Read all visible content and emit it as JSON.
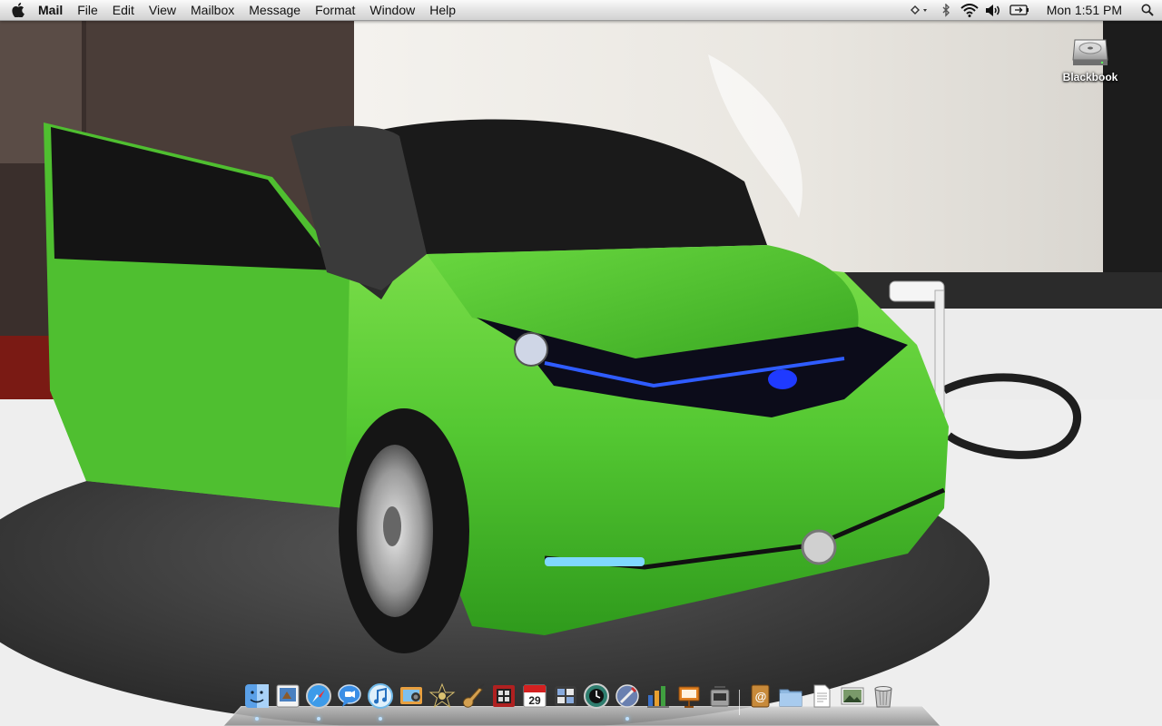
{
  "menubar": {
    "app_name": "Mail",
    "menus": [
      "File",
      "Edit",
      "View",
      "Mailbox",
      "Message",
      "Format",
      "Window",
      "Help"
    ],
    "clock": "Mon 1:51 PM",
    "status_icons": [
      "time-machine-icon",
      "bluetooth-icon",
      "wifi-icon",
      "volume-icon",
      "battery-icon"
    ]
  },
  "desktop": {
    "drive_label": "Blackbook",
    "drive_icon": "hard-drive-icon",
    "wallpaper": {
      "subject": "green-concept-car",
      "car_color": "#5ed03a",
      "floor_color": "#ededed",
      "turntable_color": "#3a3a3a"
    }
  },
  "dock": {
    "apps": [
      {
        "name": "finder",
        "icon": "finder-icon",
        "color": "#5aa0e8"
      },
      {
        "name": "preview",
        "icon": "preview-icon",
        "color": "#4a80c0"
      },
      {
        "name": "safari",
        "icon": "safari-icon",
        "color": "#3d9be9"
      },
      {
        "name": "ichat",
        "icon": "ichat-icon",
        "color": "#3a8ee6"
      },
      {
        "name": "itunes",
        "icon": "itunes-icon",
        "color": "#6fb8e8"
      },
      {
        "name": "iphoto",
        "icon": "iphoto-icon",
        "color": "#e8a040"
      },
      {
        "name": "imovie",
        "icon": "imovie-icon",
        "color": "#2b2b2b"
      },
      {
        "name": "garageband",
        "icon": "garageband-icon",
        "color": "#d4a050"
      },
      {
        "name": "photo-booth",
        "icon": "photo-booth-icon",
        "color": "#b02020"
      },
      {
        "name": "ical",
        "icon": "ical-icon",
        "color": "#ffffff",
        "date": "29"
      },
      {
        "name": "dashboard",
        "icon": "dashboard-icon",
        "color": "#3c3c3c"
      },
      {
        "name": "time-machine",
        "icon": "time-machine-dock-icon",
        "color": "#2e7d6e"
      },
      {
        "name": "script-editor",
        "icon": "script-editor-icon",
        "color": "#6a80b0"
      },
      {
        "name": "keynote",
        "icon": "keynote-icon",
        "color": "#3a70c8"
      },
      {
        "name": "presentation",
        "icon": "presentation-icon",
        "color": "#e08020"
      },
      {
        "name": "system-utility",
        "icon": "utility-icon",
        "color": "#a0a0a0"
      }
    ],
    "stacks": [
      {
        "name": "address-book",
        "icon": "address-book-icon",
        "color": "#c88a3a"
      },
      {
        "name": "documents-folder",
        "icon": "folder-icon",
        "color": "#8fb8e0"
      },
      {
        "name": "document",
        "icon": "document-icon",
        "color": "#ffffff"
      },
      {
        "name": "photos-stack",
        "icon": "photos-stack-icon",
        "color": "#7a9a6a"
      },
      {
        "name": "trash",
        "icon": "trash-icon",
        "color": "#c8c8c8"
      }
    ]
  }
}
